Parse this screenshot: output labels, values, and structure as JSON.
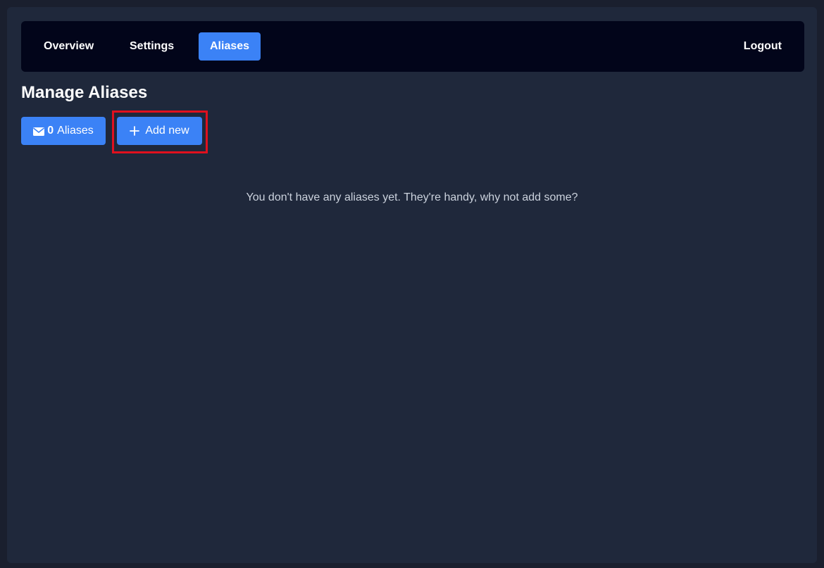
{
  "nav": {
    "overview": "Overview",
    "settings": "Settings",
    "aliases": "Aliases",
    "logout": "Logout",
    "active_color": "#3b82f6"
  },
  "page": {
    "title": "Manage Aliases",
    "empty_message": "You don't have any aliases yet. They're handy, why not add some?"
  },
  "toolbar": {
    "count_value": "0",
    "count_label": "Aliases",
    "count_icon": "envelope-icon",
    "add_label": "Add new",
    "add_icon": "plus-icon"
  },
  "colors": {
    "background": "#1f283b",
    "navbar": "#02051a",
    "accent": "#3b82f6",
    "highlight": "#e0101e"
  }
}
